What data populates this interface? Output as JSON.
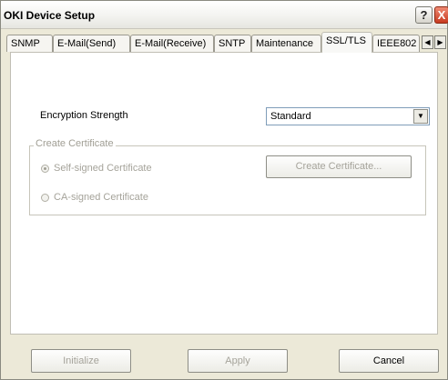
{
  "window": {
    "title": "OKI Device Setup",
    "help_label": "?",
    "close_label": "X"
  },
  "tabs": [
    {
      "label": "SNMP"
    },
    {
      "label": "E-Mail(Send)"
    },
    {
      "label": "E-Mail(Receive)"
    },
    {
      "label": "SNTP"
    },
    {
      "label": "Maintenance"
    },
    {
      "label": "SSL/TLS",
      "active": true
    },
    {
      "label": "IEEE802"
    }
  ],
  "tab_scroll": {
    "left": "◀",
    "right": "▶"
  },
  "encryption": {
    "label": "Encryption Strength",
    "value": "Standard",
    "arrow": "▼"
  },
  "certificate": {
    "group_label": "Create Certificate",
    "self_signed_label": "Self-signed Certificate",
    "ca_signed_label": "CA-signed Certificate",
    "create_button": "Create Certificate..."
  },
  "footer": {
    "initialize": "Initialize",
    "apply": "Apply",
    "cancel": "Cancel"
  }
}
